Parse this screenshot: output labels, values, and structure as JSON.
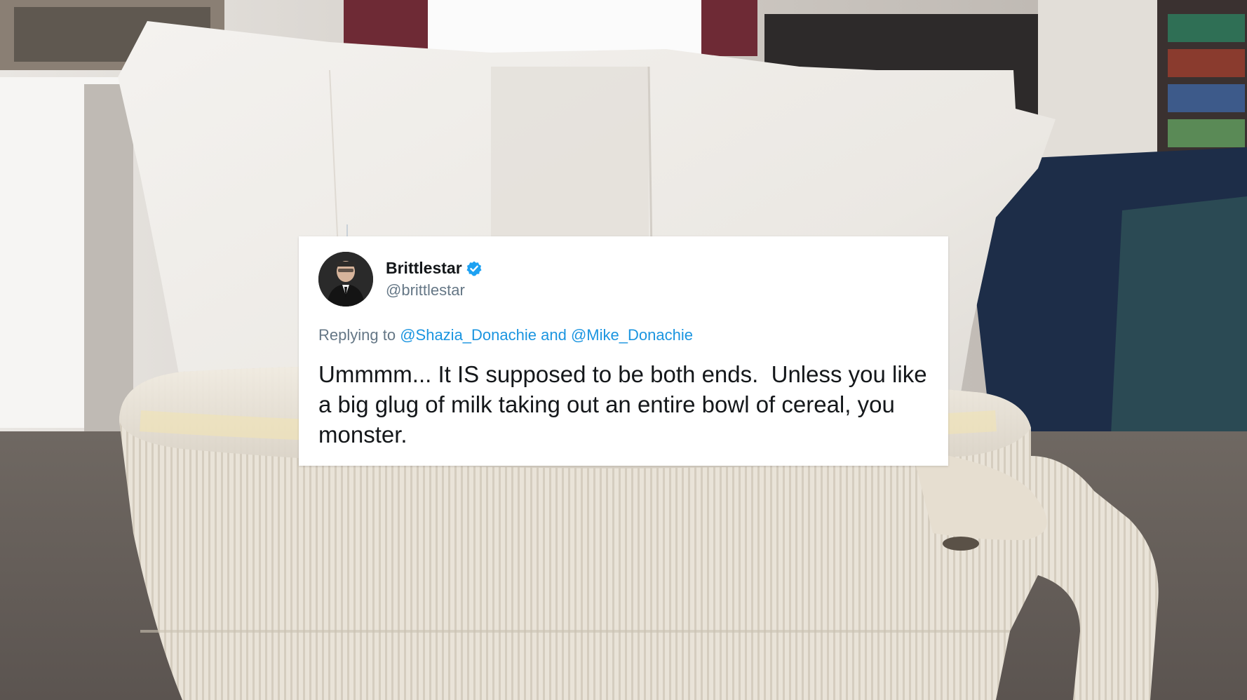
{
  "tweet": {
    "author_name": "Brittlestar",
    "author_handle": "@brittlestar",
    "reply_prefix": "Replying to",
    "reply_mention_1": "@Shazia_Donachie",
    "reply_joiner": "and",
    "reply_mention_2": "@Mike_Donachie",
    "text": "Ummmm... It IS supposed to be both ends.  Unless you like a big glug of milk taking out an entire bowl of cereal, you monster.",
    "verified_color": "#1da1f2",
    "mention_color": "#1b95e0"
  },
  "icons": {
    "verified": "verified-badge-icon"
  }
}
